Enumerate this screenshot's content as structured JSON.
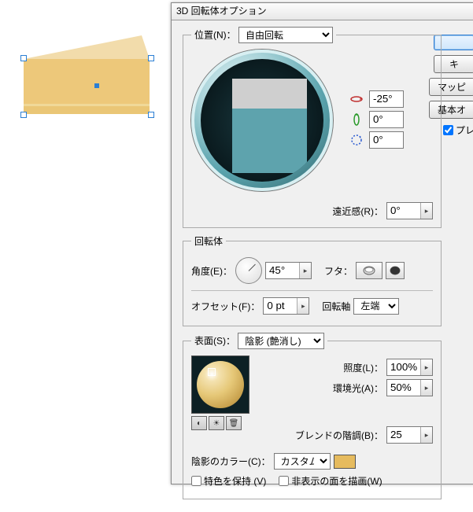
{
  "dialog": {
    "title": "3D 回転体オプション",
    "position": {
      "legend": "位置(N)：",
      "mode": "自由回転",
      "rotX": "-25°",
      "rotY": "0°",
      "rotZ": "0°",
      "perspectiveLabel": "遠近感(R)：",
      "perspective": "0°"
    },
    "revolve": {
      "legend": "回転体",
      "angleLabel": "角度(E)：",
      "angle": "45°",
      "capLabel": "フタ：",
      "offsetLabel": "オフセット(F)：",
      "offset": "0 pt",
      "axisLabel": "回転軸",
      "axis": "左端"
    },
    "surface": {
      "legend": "表面(S)：",
      "mode": "陰影 (艶消し)",
      "lightLabel": "照度(L)：",
      "light": "100%",
      "ambientLabel": "環境光(A)：",
      "ambient": "50%",
      "blendLabel": "ブレンドの階調(B)：",
      "blend": "25",
      "shadeColorLabel": "陰影のカラー(C)：",
      "shadeColor": "カスタム",
      "preserveSpot": "特色を保持 (V)",
      "drawHidden": "非表示の面を描画(W)"
    },
    "buttons": {
      "ok": "",
      "cancel": "キ",
      "mapping": "マッピ",
      "more": "基本オ",
      "preview": "プレ"
    }
  }
}
